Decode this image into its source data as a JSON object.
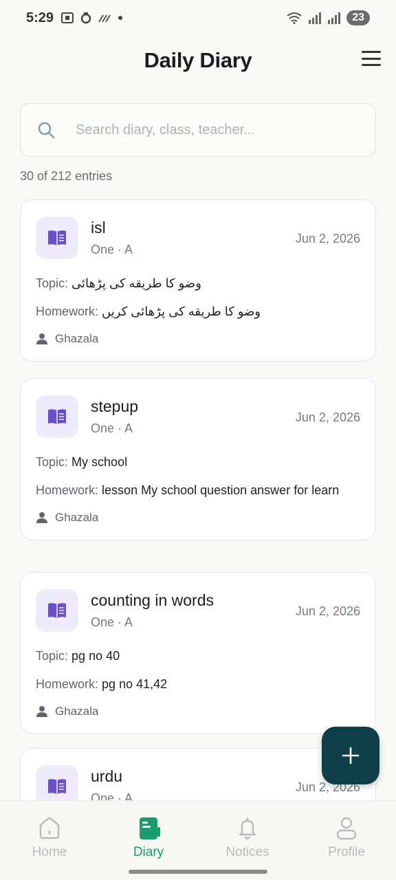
{
  "status_bar": {
    "time": "5:29",
    "battery": "23"
  },
  "header": {
    "title": "Daily Diary"
  },
  "search": {
    "placeholder": "Search diary, class, teacher..."
  },
  "entries_count": "30 of 212 entries",
  "labels": {
    "topic": "Topic:",
    "homework": "Homework:"
  },
  "entries": [
    {
      "subject": "isl",
      "class": "One · A",
      "date": "Jun 2, 2026",
      "topic": "وضو کا طریقه کی پڑھائی",
      "homework": "وضو کا طریقه کی پڑھائی کریں",
      "teacher": "Ghazala"
    },
    {
      "subject": "stepup",
      "class": "One · A",
      "date": "Jun 2, 2026",
      "topic": "My school",
      "homework": "lesson My school question answer for learn",
      "teacher": "Ghazala"
    },
    {
      "subject": "counting in words",
      "class": "One · A",
      "date": "Jun 2, 2026",
      "topic": "pg no 40",
      "homework": "pg no 41,42",
      "teacher": "Ghazala"
    },
    {
      "subject": "urdu",
      "class": "One · A",
      "date": "Jun 2, 2026"
    }
  ],
  "nav": {
    "items": [
      {
        "label": "Home",
        "icon": "home-icon"
      },
      {
        "label": "Diary",
        "icon": "diary-icon",
        "active": true
      },
      {
        "label": "Notices",
        "icon": "bell-icon"
      },
      {
        "label": "Profile",
        "icon": "profile-icon"
      }
    ]
  },
  "colors": {
    "accent": "#1c9b6f",
    "fab": "#0e3e47",
    "subject_icon_bg": "#efebfa",
    "subject_icon": "#6b4fc4"
  }
}
